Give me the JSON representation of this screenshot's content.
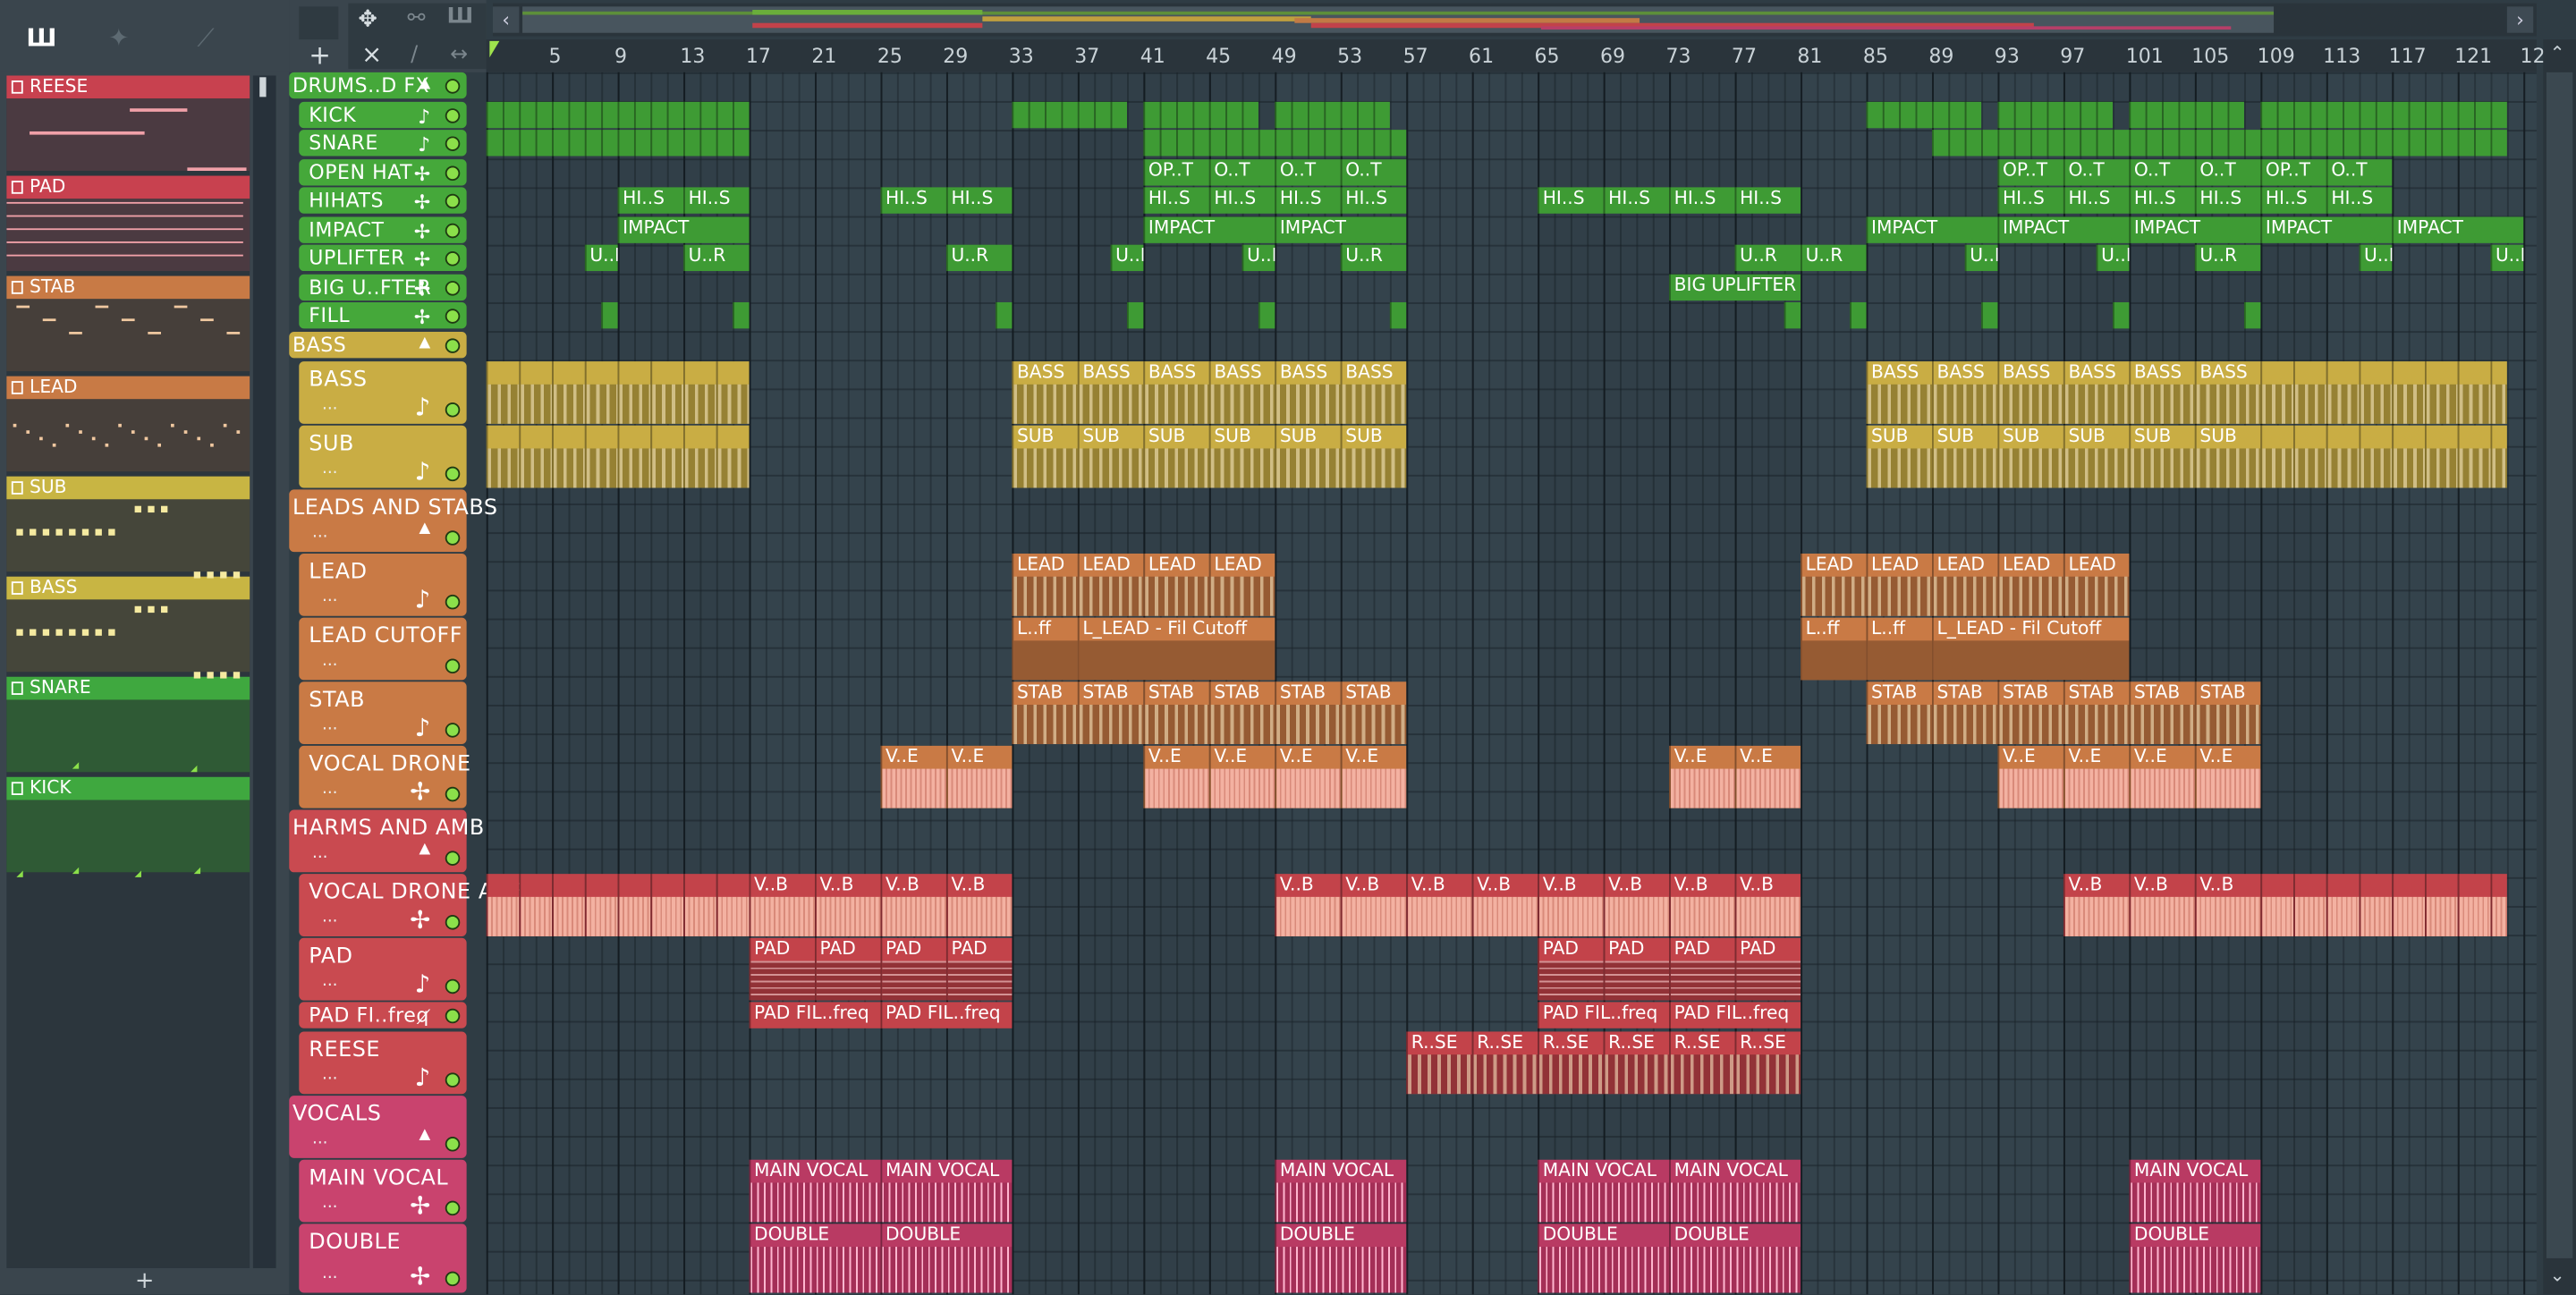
{
  "toolbar": {
    "tool_icons": [
      "piano-roll-icon",
      "bird-icon",
      "brush-icon"
    ],
    "add_label": "+",
    "delete_label": "×"
  },
  "ruler": {
    "bars": [
      "5",
      "9",
      "13",
      "17",
      "21",
      "25",
      "29",
      "33",
      "37",
      "41",
      "45",
      "49",
      "53",
      "57",
      "61",
      "65",
      "69",
      "73",
      "77",
      "81",
      "85",
      "89",
      "93",
      "97",
      "101",
      "105",
      "109",
      "113",
      "117",
      "121",
      "12"
    ]
  },
  "picker": {
    "items": [
      {
        "label": "REESE",
        "color": "#c8414f"
      },
      {
        "label": "PAD",
        "color": "#c8414f"
      },
      {
        "label": "STAB",
        "color": "#c87a45"
      },
      {
        "label": "LEAD",
        "color": "#c87a45"
      },
      {
        "label": "SUB",
        "color": "#c8b543"
      },
      {
        "label": "BASS",
        "color": "#c8b543"
      },
      {
        "label": "SNARE",
        "color": "#3fa83f"
      },
      {
        "label": "KICK",
        "color": "#3fa83f"
      }
    ],
    "add_label": "+"
  },
  "groups": [
    {
      "label": "DRUMS..D FX",
      "color": "#45a83a"
    },
    {
      "label": "BASS",
      "color": "#c9ad44"
    },
    {
      "label": "LEADS AND STABS",
      "color": "#c97a45"
    },
    {
      "label": "HARMS AND AMB",
      "color": "#c94a50"
    },
    {
      "label": "VOCALS",
      "color": "#c9436e"
    }
  ],
  "tracks": {
    "kick": "KICK",
    "snare": "SNARE",
    "open_hat": "OPEN HAT",
    "hihats": "HIHATS",
    "impact": "IMPACT",
    "uplifter": "UPLIFTER",
    "big_uplifter": "BIG U..FTER",
    "fill": "FILL",
    "bass": "BASS",
    "sub": "SUB",
    "lead": "LEAD",
    "lead_cutoff": "LEAD CUTOFF",
    "stab": "STAB",
    "vocal_drone": "VOCAL DRONE",
    "vocal_drone_amb": "VOCAL DRONE AMB",
    "pad": "PAD",
    "pad_filter": "PAD FI..freq",
    "reese": "REESE",
    "main_vocal": "MAIN VOCAL",
    "double": "DOUBLE"
  },
  "track_ellipsis": "...",
  "clip_labels": {
    "opt": "OP..T",
    "ot": "O..T",
    "hi_s": "HI..S",
    "impact": "IMPACT",
    "u_r": "U..R",
    "big_uplifter": "BIG UPLIFTER",
    "bass": "BASS",
    "sub": "SUB",
    "lead": "LEAD",
    "lead_cutoff_short": "L..ff",
    "lead_cutoff_long": "L_LEAD - Fil Cutoff",
    "stab": "STAB",
    "v_e": "V..E",
    "v_b": "V..B",
    "pad": "PAD",
    "pad_filter": "PAD FIL..freq",
    "r_se": "R..SE",
    "main_vocal": "MAIN VOCAL",
    "double": "DOUBLE"
  },
  "colors": {
    "drums": "#45a83a",
    "bass": "#c9ad44",
    "leads": "#c97a45",
    "harms": "#c94a50",
    "vocals": "#c9436e",
    "mute_led": "#8be04a",
    "playhead": "#9fe34d"
  }
}
